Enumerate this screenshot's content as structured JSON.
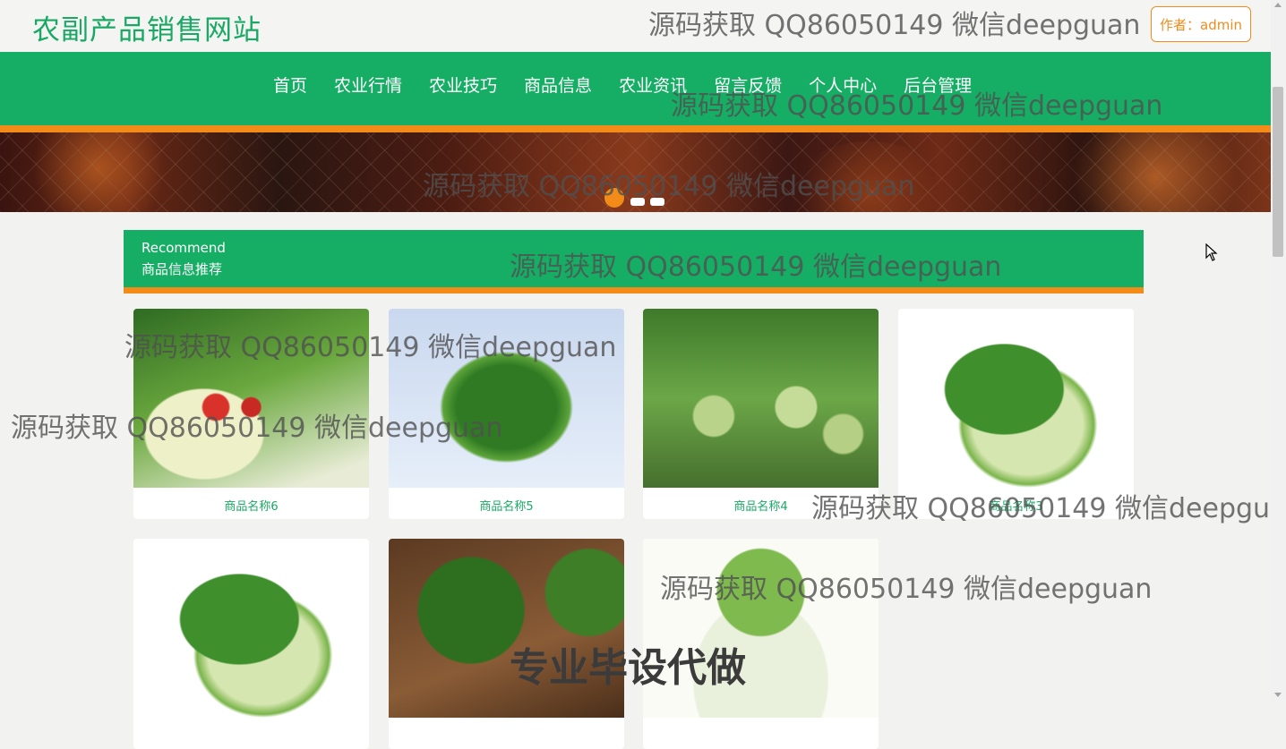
{
  "header": {
    "site_title": "农副产品销售网站",
    "author_label": "作者：admin"
  },
  "nav": {
    "items": [
      "首页",
      "农业行情",
      "农业技巧",
      "商品信息",
      "农业资讯",
      "留言反馈",
      "个人中心",
      "后台管理"
    ]
  },
  "section": {
    "title_en": "Recommend",
    "title_cn": "商品信息推荐"
  },
  "products": [
    {
      "name": "商品名称6"
    },
    {
      "name": "商品名称5"
    },
    {
      "name": "商品名称4"
    },
    {
      "name": "商品名称3"
    },
    {
      "name": ""
    },
    {
      "name": ""
    },
    {
      "name": ""
    }
  ],
  "watermarks": {
    "text": "源码获取 QQ86050149 微信deepguan",
    "bottom": "专业毕设代做"
  },
  "colors": {
    "brand_green": "#16ae65",
    "accent_orange": "#f28b17"
  }
}
